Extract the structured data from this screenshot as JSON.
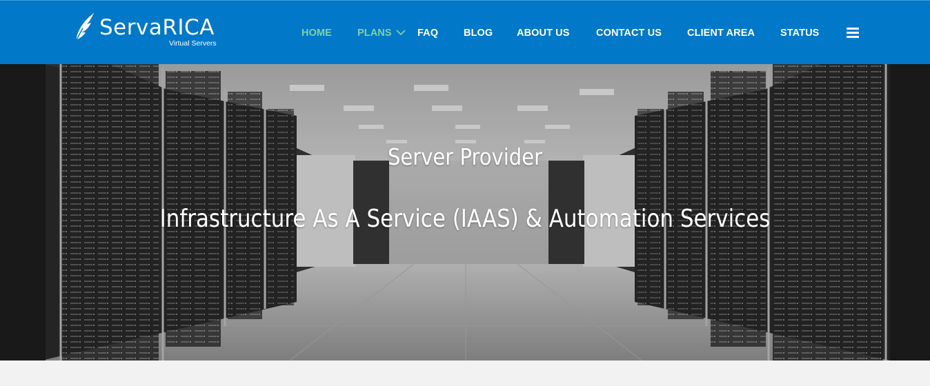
{
  "brand": {
    "name": "ServaRICA",
    "tagline": "Virtual Servers",
    "logo_icon": "feather-icon"
  },
  "nav": {
    "items": [
      {
        "label": "HOME",
        "active": true
      },
      {
        "label": "PLANS",
        "active": true,
        "has_dropdown": true
      },
      {
        "label": "FAQ",
        "active": false
      },
      {
        "label": "BLOG",
        "active": false
      },
      {
        "label": "ABOUT US",
        "active": false
      },
      {
        "label": "CONTACT US",
        "active": false
      },
      {
        "label": "CLIENT AREA",
        "active": false
      },
      {
        "label": "STATUS",
        "active": false
      }
    ],
    "menu_icon": "hamburger-menu-icon"
  },
  "hero": {
    "title": "Server Provider",
    "subtitle": "Infrastructure As A Service (IAAS) & Automation Services",
    "background": "server-room-photo"
  },
  "colors": {
    "header_bg": "#0178c8",
    "nav_active": "#7fd3a2",
    "nav_text": "#ffffff",
    "page_bg": "#f2f2f2"
  }
}
